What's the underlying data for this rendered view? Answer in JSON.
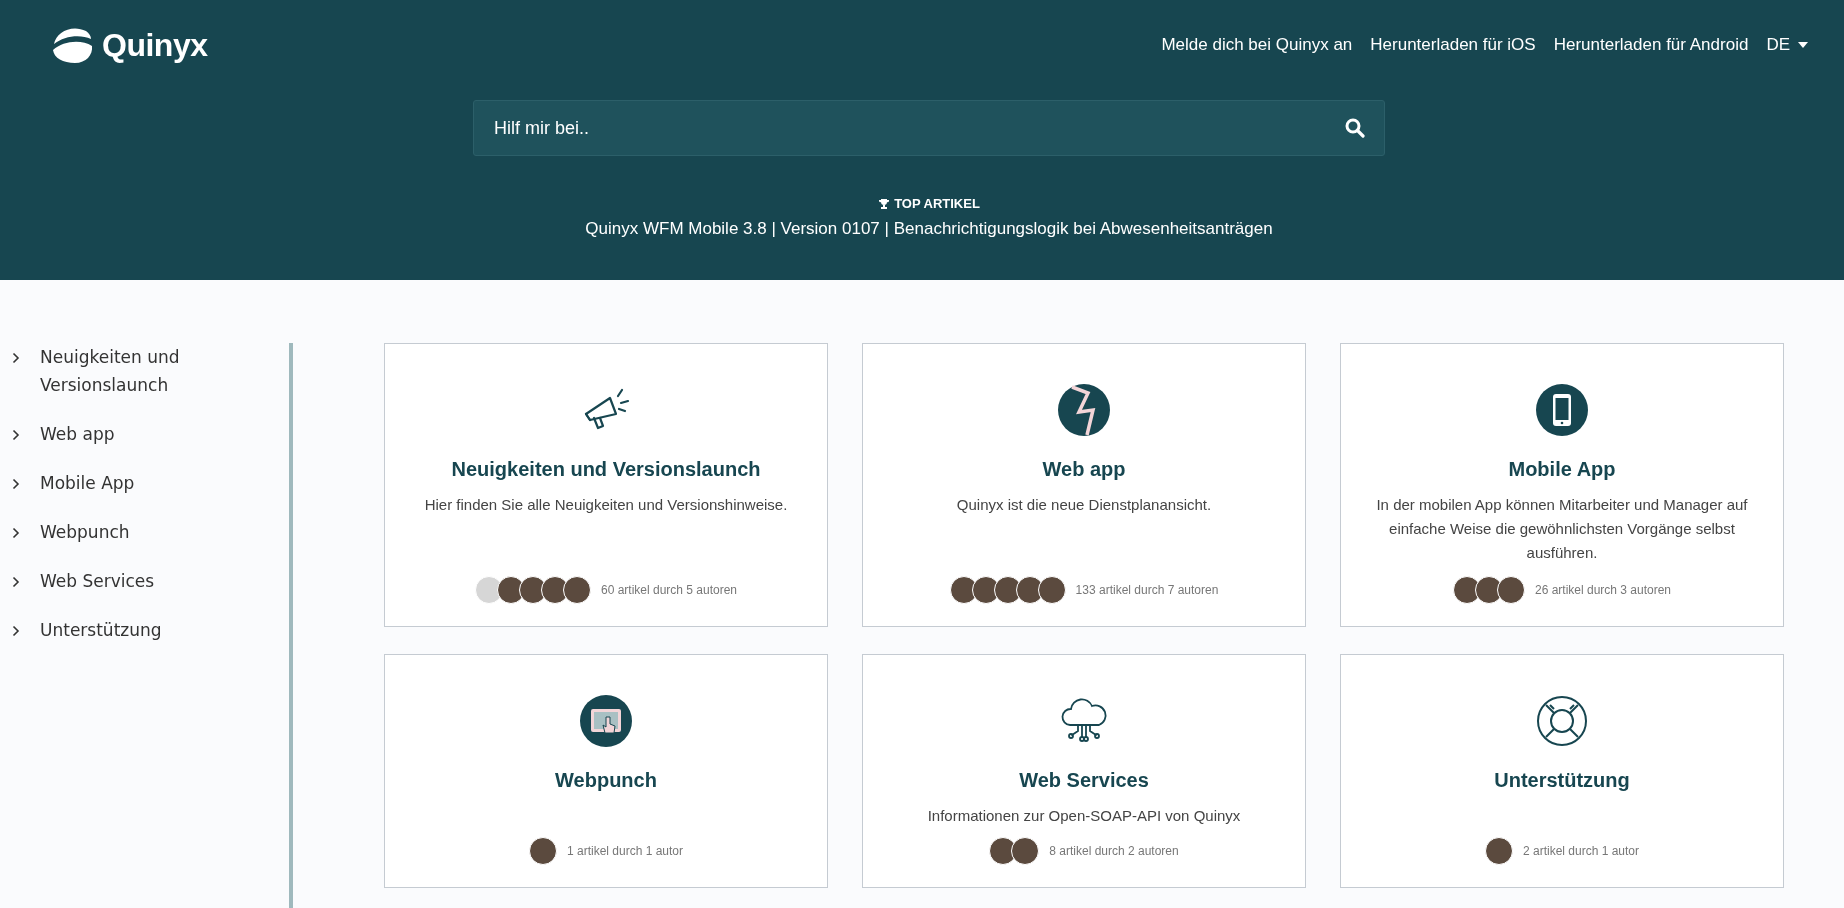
{
  "header": {
    "logo": "Quinyx",
    "nav": [
      "Melde dich bei Quinyx an",
      "Herunterladen für iOS",
      "Herunterladen für Android"
    ],
    "language": "DE"
  },
  "search": {
    "placeholder": "Hilf mir bei.."
  },
  "top_article": {
    "label": "TOP ARTIKEL",
    "title": "Quinyx WFM Mobile 3.8 | Version 0107 | Benachrichtigungslogik bei Abwesenheitsanträgen"
  },
  "sidebar": {
    "items": [
      "Neuigkeiten und Versionslaunch",
      "Web app",
      "Mobile App",
      "Webpunch",
      "Web Services",
      "Unterstützung"
    ]
  },
  "categories": [
    {
      "title": "Neuigkeiten und Versionslaunch",
      "description": "Hier finden Sie alle Neuigkeiten und Versionshinweise.",
      "avatars": [
        {
          "kind": "placeholder"
        },
        {
          "kind": "photo"
        },
        {
          "kind": "photo"
        },
        {
          "kind": "photo"
        },
        {
          "kind": "photo"
        }
      ],
      "stats": "60 artikel durch 5 autoren"
    },
    {
      "title": "Web app",
      "description": "Quinyx ist die neue Dienstplanansicht.",
      "avatars": [
        {
          "kind": "photo"
        },
        {
          "kind": "photo"
        },
        {
          "kind": "photo"
        },
        {
          "kind": "photo"
        },
        {
          "kind": "photo"
        }
      ],
      "stats": "133 artikel durch 7 autoren"
    },
    {
      "title": "Mobile App",
      "description": "In der mobilen App können Mitarbeiter und Manager auf einfache Weise die gewöhnlichsten Vorgänge selbst ausführen.",
      "avatars": [
        {
          "kind": "photo"
        },
        {
          "kind": "photo"
        },
        {
          "kind": "photo"
        }
      ],
      "stats": "26 artikel durch 3 autoren"
    },
    {
      "title": "Webpunch",
      "avatars": [
        {
          "kind": "photo"
        }
      ],
      "stats": "1 artikel durch 1 autor"
    },
    {
      "title": "Web Services",
      "description": "Informationen zur Open-SOAP-API von Quinyx",
      "avatars": [
        {
          "kind": "photo"
        },
        {
          "kind": "photo"
        }
      ],
      "stats": "8 artikel durch 2 autoren"
    },
    {
      "title": "Unterstützung",
      "avatars": [
        {
          "kind": "photo"
        }
      ],
      "stats": "2 artikel durch 1 autor"
    }
  ]
}
